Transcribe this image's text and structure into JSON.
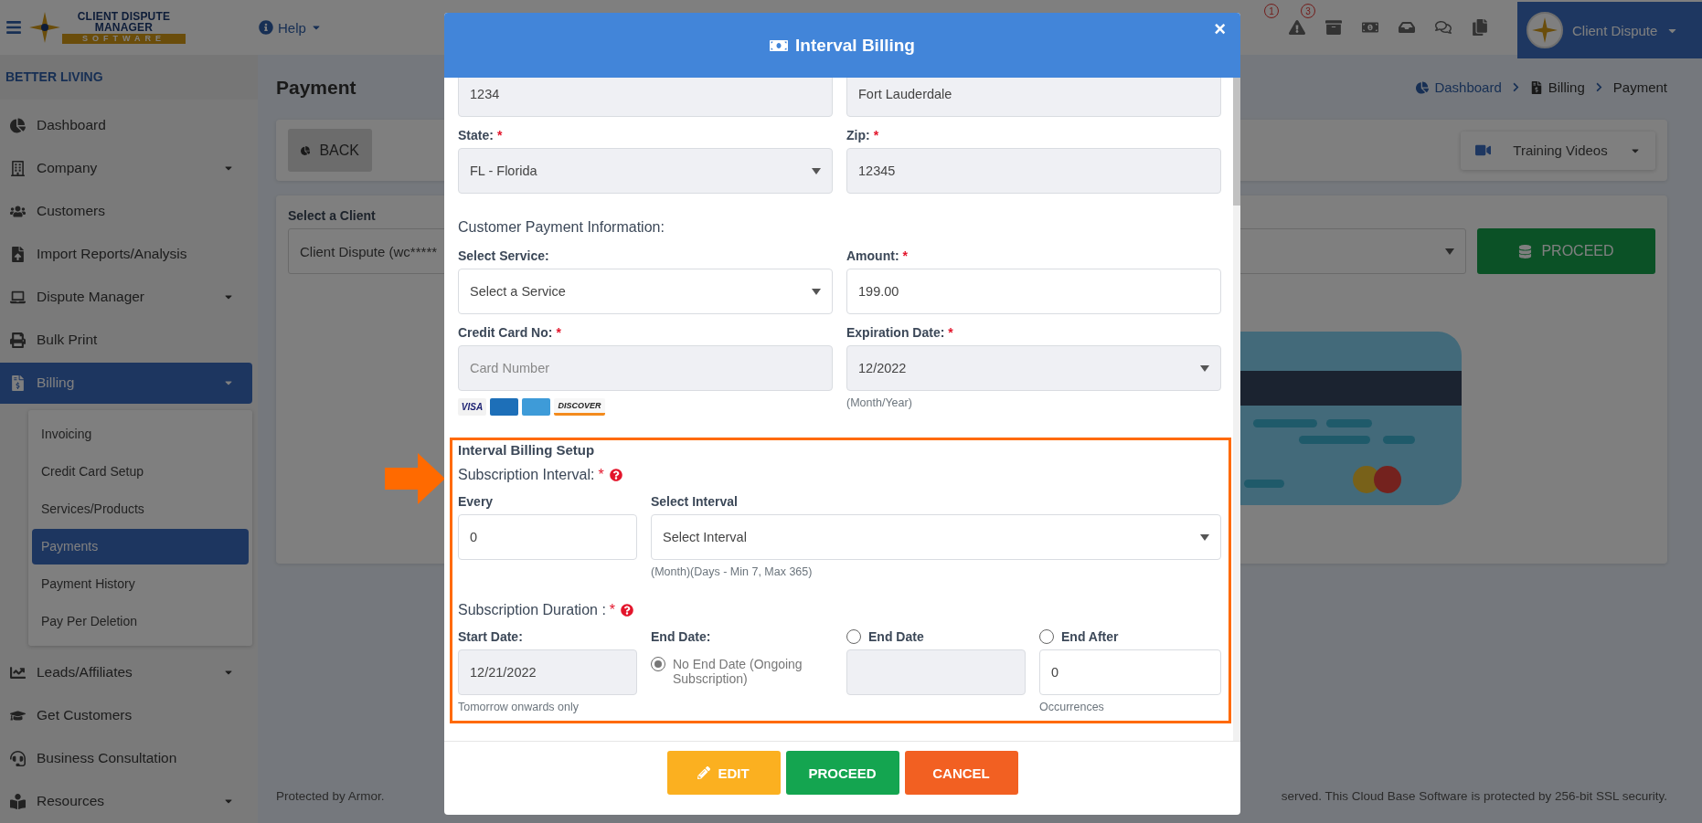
{
  "topbar": {
    "logo": {
      "line1": "CLIENT DISPUTE",
      "line2": "MANAGER",
      "line3": "SOFTWARE"
    },
    "help": "Help",
    "badges": [
      "1",
      "3"
    ],
    "user": "Client Dispute"
  },
  "sidebar": {
    "company": "BETTER LIVING",
    "items": [
      {
        "label": "Dashboard",
        "expandable": false,
        "selected": false
      },
      {
        "label": "Company",
        "expandable": true,
        "selected": false
      },
      {
        "label": "Customers",
        "expandable": false,
        "selected": false
      },
      {
        "label": "Import Reports/Analysis",
        "expandable": false,
        "selected": false
      },
      {
        "label": "Dispute Manager",
        "expandable": true,
        "selected": false
      },
      {
        "label": "Bulk Print",
        "expandable": false,
        "selected": false
      },
      {
        "label": "Billing",
        "expandable": true,
        "selected": true,
        "children": [
          {
            "label": "Invoicing",
            "selected": false
          },
          {
            "label": "Credit Card Setup",
            "selected": false
          },
          {
            "label": "Services/Products",
            "selected": false
          },
          {
            "label": "Payments",
            "selected": true
          },
          {
            "label": "Payment History",
            "selected": false
          },
          {
            "label": "Pay Per Deletion",
            "selected": false
          }
        ]
      },
      {
        "label": "Leads/Affiliates",
        "expandable": true,
        "selected": false
      },
      {
        "label": "Get Customers",
        "expandable": false,
        "selected": false
      },
      {
        "label": "Business Consultation",
        "expandable": false,
        "selected": false
      },
      {
        "label": "Resources",
        "expandable": true,
        "selected": false
      }
    ]
  },
  "page": {
    "title": "Payment",
    "breadcrumb": [
      "Dashboard",
      "Billing",
      "Payment"
    ],
    "back": "BACK",
    "training": "Training Videos",
    "client_label": "Select a Client",
    "client_value": "Client Dispute (wc*****",
    "proceed": "PROCEED",
    "footer_left": "Protected by Armor.",
    "footer_right": "served. This Cloud Base Software is protected by 256-bit SSL security."
  },
  "modal": {
    "title": "Interval Billing",
    "close": "×",
    "rows": [
      {
        "kind": "fields",
        "fields": [
          {
            "kind": "locked",
            "value": "1234"
          },
          {
            "kind": "locked",
            "value": "Fort Lauderdale"
          }
        ]
      },
      {
        "kind": "fields",
        "fields": [
          {
            "label": "State:",
            "mark": "*",
            "kind": "locked-select",
            "value": "FL - Florida"
          },
          {
            "label": "Zip:",
            "mark": "*",
            "kind": "locked",
            "value": "12345"
          }
        ]
      },
      {
        "kind": "heading",
        "text": "Customer Payment Information:"
      },
      {
        "kind": "fields",
        "fields": [
          {
            "label": "Select Service:",
            "kind": "select",
            "value": "Select a Service"
          },
          {
            "label": "Amount:",
            "mark": "*",
            "kind": "text",
            "value": "199.00"
          }
        ]
      },
      {
        "kind": "fields",
        "fields": [
          {
            "label": "Credit Card No:",
            "mark": "*",
            "kind": "locked",
            "placeholder": "Card Number",
            "cards": [
              {
                "kind": "visa",
                "text": "VISA"
              },
              {
                "kind": "mastercard"
              },
              {
                "kind": "amex"
              },
              {
                "kind": "discover",
                "text": "DISCOVER"
              }
            ]
          },
          {
            "label": "Expiration Date:",
            "mark": "*",
            "kind": "locked-select",
            "value": "12/2022",
            "hint": "(Month/Year)"
          }
        ]
      }
    ],
    "interval": {
      "title": "Interval Billing Setup",
      "interval_label": "Subscription Interval:",
      "mark": "*",
      "every": {
        "label": "Every",
        "value": "0"
      },
      "select_interval": {
        "label": "Select Interval",
        "value": "Select Interval",
        "hint": "(Month)(Days - Min 7, Max 365)"
      },
      "duration_label": "Subscription Duration :",
      "start": {
        "label": "Start Date:",
        "value": "12/21/2022",
        "hint": "Tomorrow onwards only"
      },
      "end_label": "End Date:",
      "end_options": [
        {
          "kind": "none",
          "label": "No End Date (Ongoing Subscription)",
          "selected": true
        },
        {
          "kind": "date",
          "label": "End Date",
          "selected": false
        },
        {
          "kind": "count",
          "label": "End After",
          "selected": false,
          "value": "0",
          "hint": "Occurrences"
        }
      ]
    },
    "buttons": [
      {
        "kind": "edit",
        "label": "EDIT"
      },
      {
        "kind": "proceed",
        "label": "PROCEED"
      },
      {
        "kind": "cancel",
        "label": "CANCEL"
      }
    ]
  }
}
